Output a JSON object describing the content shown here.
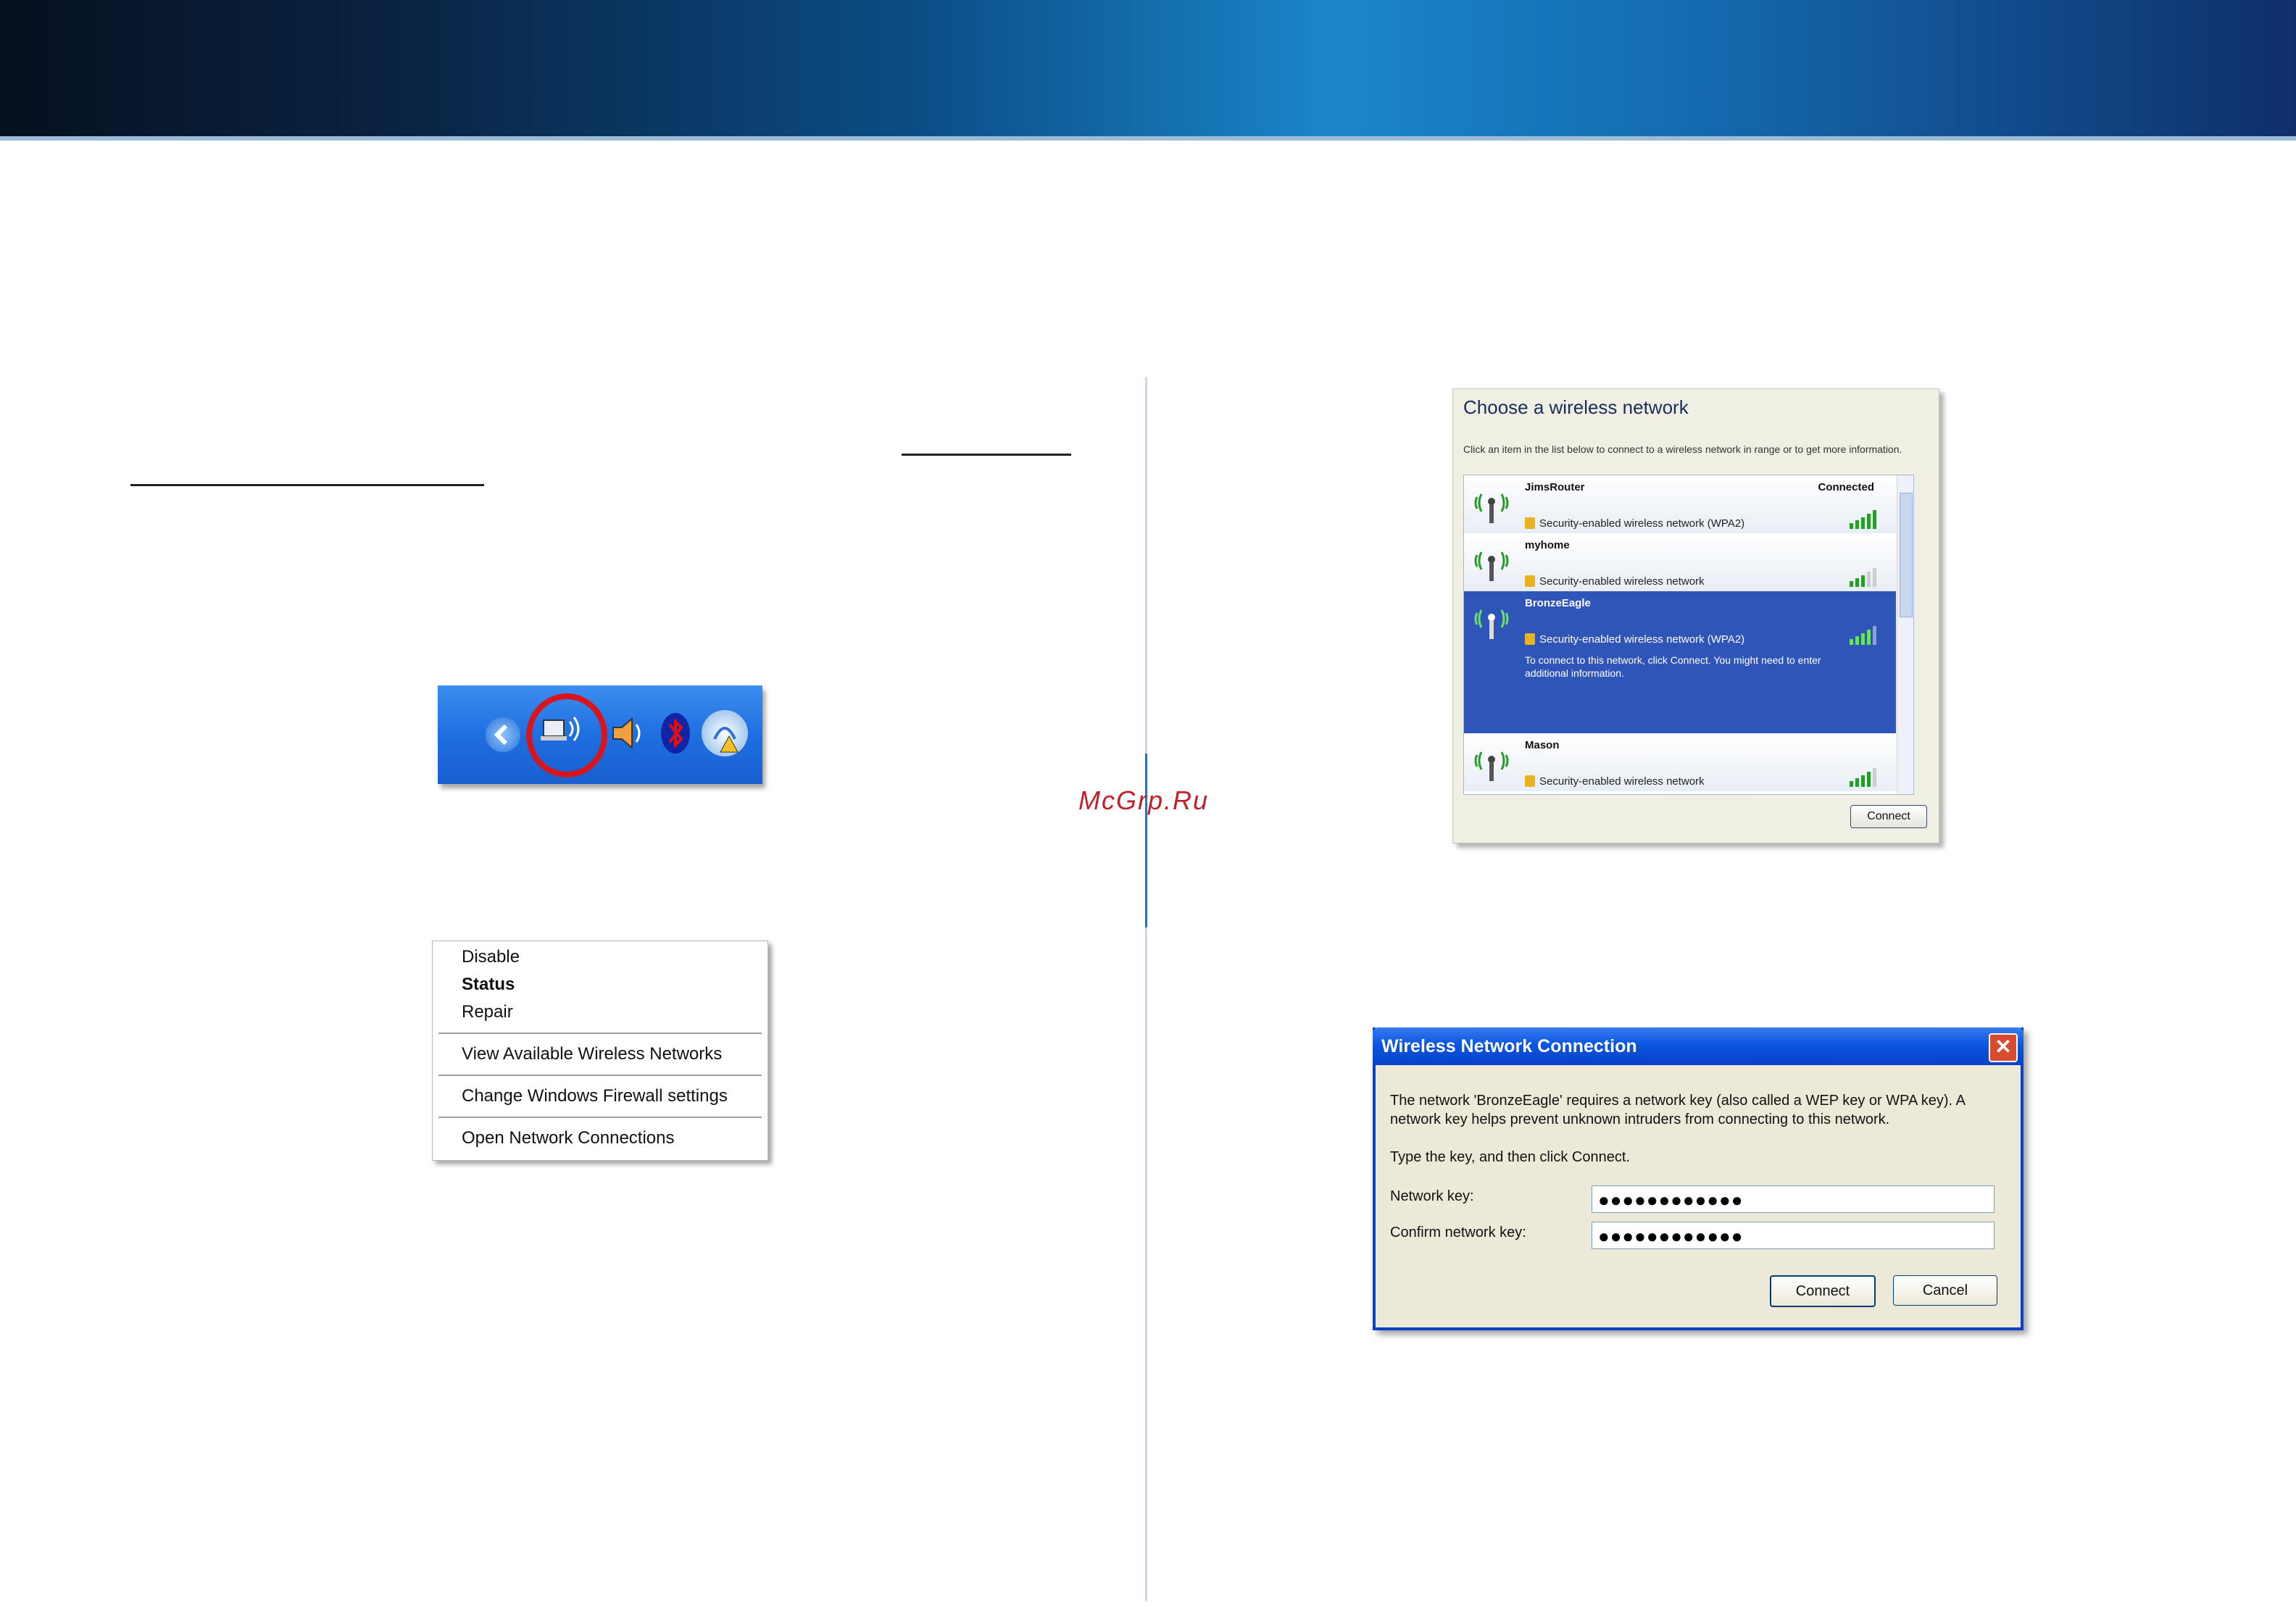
{
  "watermark": "McGrp.Ru",
  "context_menu": {
    "items": [
      "Disable",
      "Status",
      "Repair",
      "View Available Wireless Networks",
      "Change Windows Firewall settings",
      "Open Network Connections"
    ]
  },
  "choose_network": {
    "title": "Choose a wireless network",
    "description": "Click an item in the list below to connect to a wireless network in range or to get more information.",
    "networks": [
      {
        "name": "JimsRouter",
        "security": "Security-enabled wireless network (WPA2)",
        "status": "Connected",
        "signal_bars": 5
      },
      {
        "name": "myhome",
        "security": "Security-enabled wireless network",
        "signal_bars": 3
      },
      {
        "name": "BronzeEagle",
        "security": "Security-enabled wireless network (WPA2)",
        "extra": "To connect to this network, click Connect. You might need to enter additional information.",
        "signal_bars": 4,
        "selected": true
      },
      {
        "name": "Mason",
        "security": "Security-enabled wireless network",
        "signal_bars": 4
      }
    ],
    "connect_label": "Connect"
  },
  "wnc_dialog": {
    "title": "Wireless Network Connection",
    "message": "The network 'BronzeEagle' requires a network key (also called a WEP key or WPA key). A network key helps prevent unknown intruders from connecting to this network.",
    "instruction": "Type the key, and then click Connect.",
    "network_key_label": "Network key:",
    "confirm_key_label": "Confirm network key:",
    "network_key_value": "●●●●●●●●●●●●",
    "confirm_key_value": "●●●●●●●●●●●●",
    "connect_label": "Connect",
    "cancel_label": "Cancel",
    "close_glyph": "✕"
  },
  "colors": {
    "accent": "#0b55e0",
    "selection": "#2f55b8",
    "header": "#0b4d86"
  }
}
